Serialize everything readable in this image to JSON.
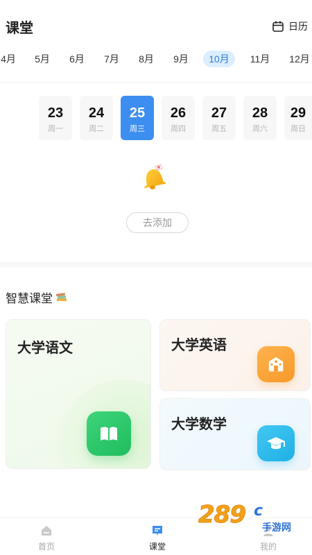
{
  "header": {
    "title": "课堂",
    "calendar_label": "日历",
    "calendar_icon": "calendar-icon"
  },
  "months": [
    {
      "label": "4月",
      "active": false
    },
    {
      "label": "5月",
      "active": false
    },
    {
      "label": "6月",
      "active": false
    },
    {
      "label": "7月",
      "active": false
    },
    {
      "label": "8月",
      "active": false
    },
    {
      "label": "9月",
      "active": false
    },
    {
      "label": "10月",
      "active": true
    },
    {
      "label": "11月",
      "active": false
    },
    {
      "label": "12月",
      "active": false
    }
  ],
  "days": [
    {
      "num": "23",
      "weekday": "周一",
      "active": false
    },
    {
      "num": "24",
      "weekday": "周二",
      "active": false
    },
    {
      "num": "25",
      "weekday": "周三",
      "active": true
    },
    {
      "num": "26",
      "weekday": "周四",
      "active": false
    },
    {
      "num": "27",
      "weekday": "周五",
      "active": false
    },
    {
      "num": "28",
      "weekday": "周六",
      "active": false
    },
    {
      "num": "29",
      "weekday": "周日",
      "active": false
    }
  ],
  "empty_state": {
    "icon": "bell-icon",
    "add_label": "去添加"
  },
  "smart_class": {
    "title": "智慧课堂",
    "icon": "books-icon",
    "courses": [
      {
        "name": "大学语文",
        "icon": "book-icon",
        "color": "#22c063"
      },
      {
        "name": "大学英语",
        "icon": "school-icon",
        "color": "#f9a235"
      },
      {
        "name": "大学数学",
        "icon": "graduation-cap-icon",
        "color": "#2bb8ea"
      }
    ]
  },
  "tabbar": {
    "items": [
      {
        "label": "首页",
        "icon": "home-icon",
        "active": false
      },
      {
        "label": "课堂",
        "icon": "classroom-icon",
        "active": true
      },
      {
        "label": "我的",
        "icon": "profile-icon",
        "active": false
      }
    ]
  },
  "watermark": {
    "num": "289",
    "com": "c",
    "sub": "手游网"
  },
  "colors": {
    "accent": "#3c8ef0",
    "month_active_bg": "#dceeff",
    "month_active_text": "#2a7de1"
  }
}
